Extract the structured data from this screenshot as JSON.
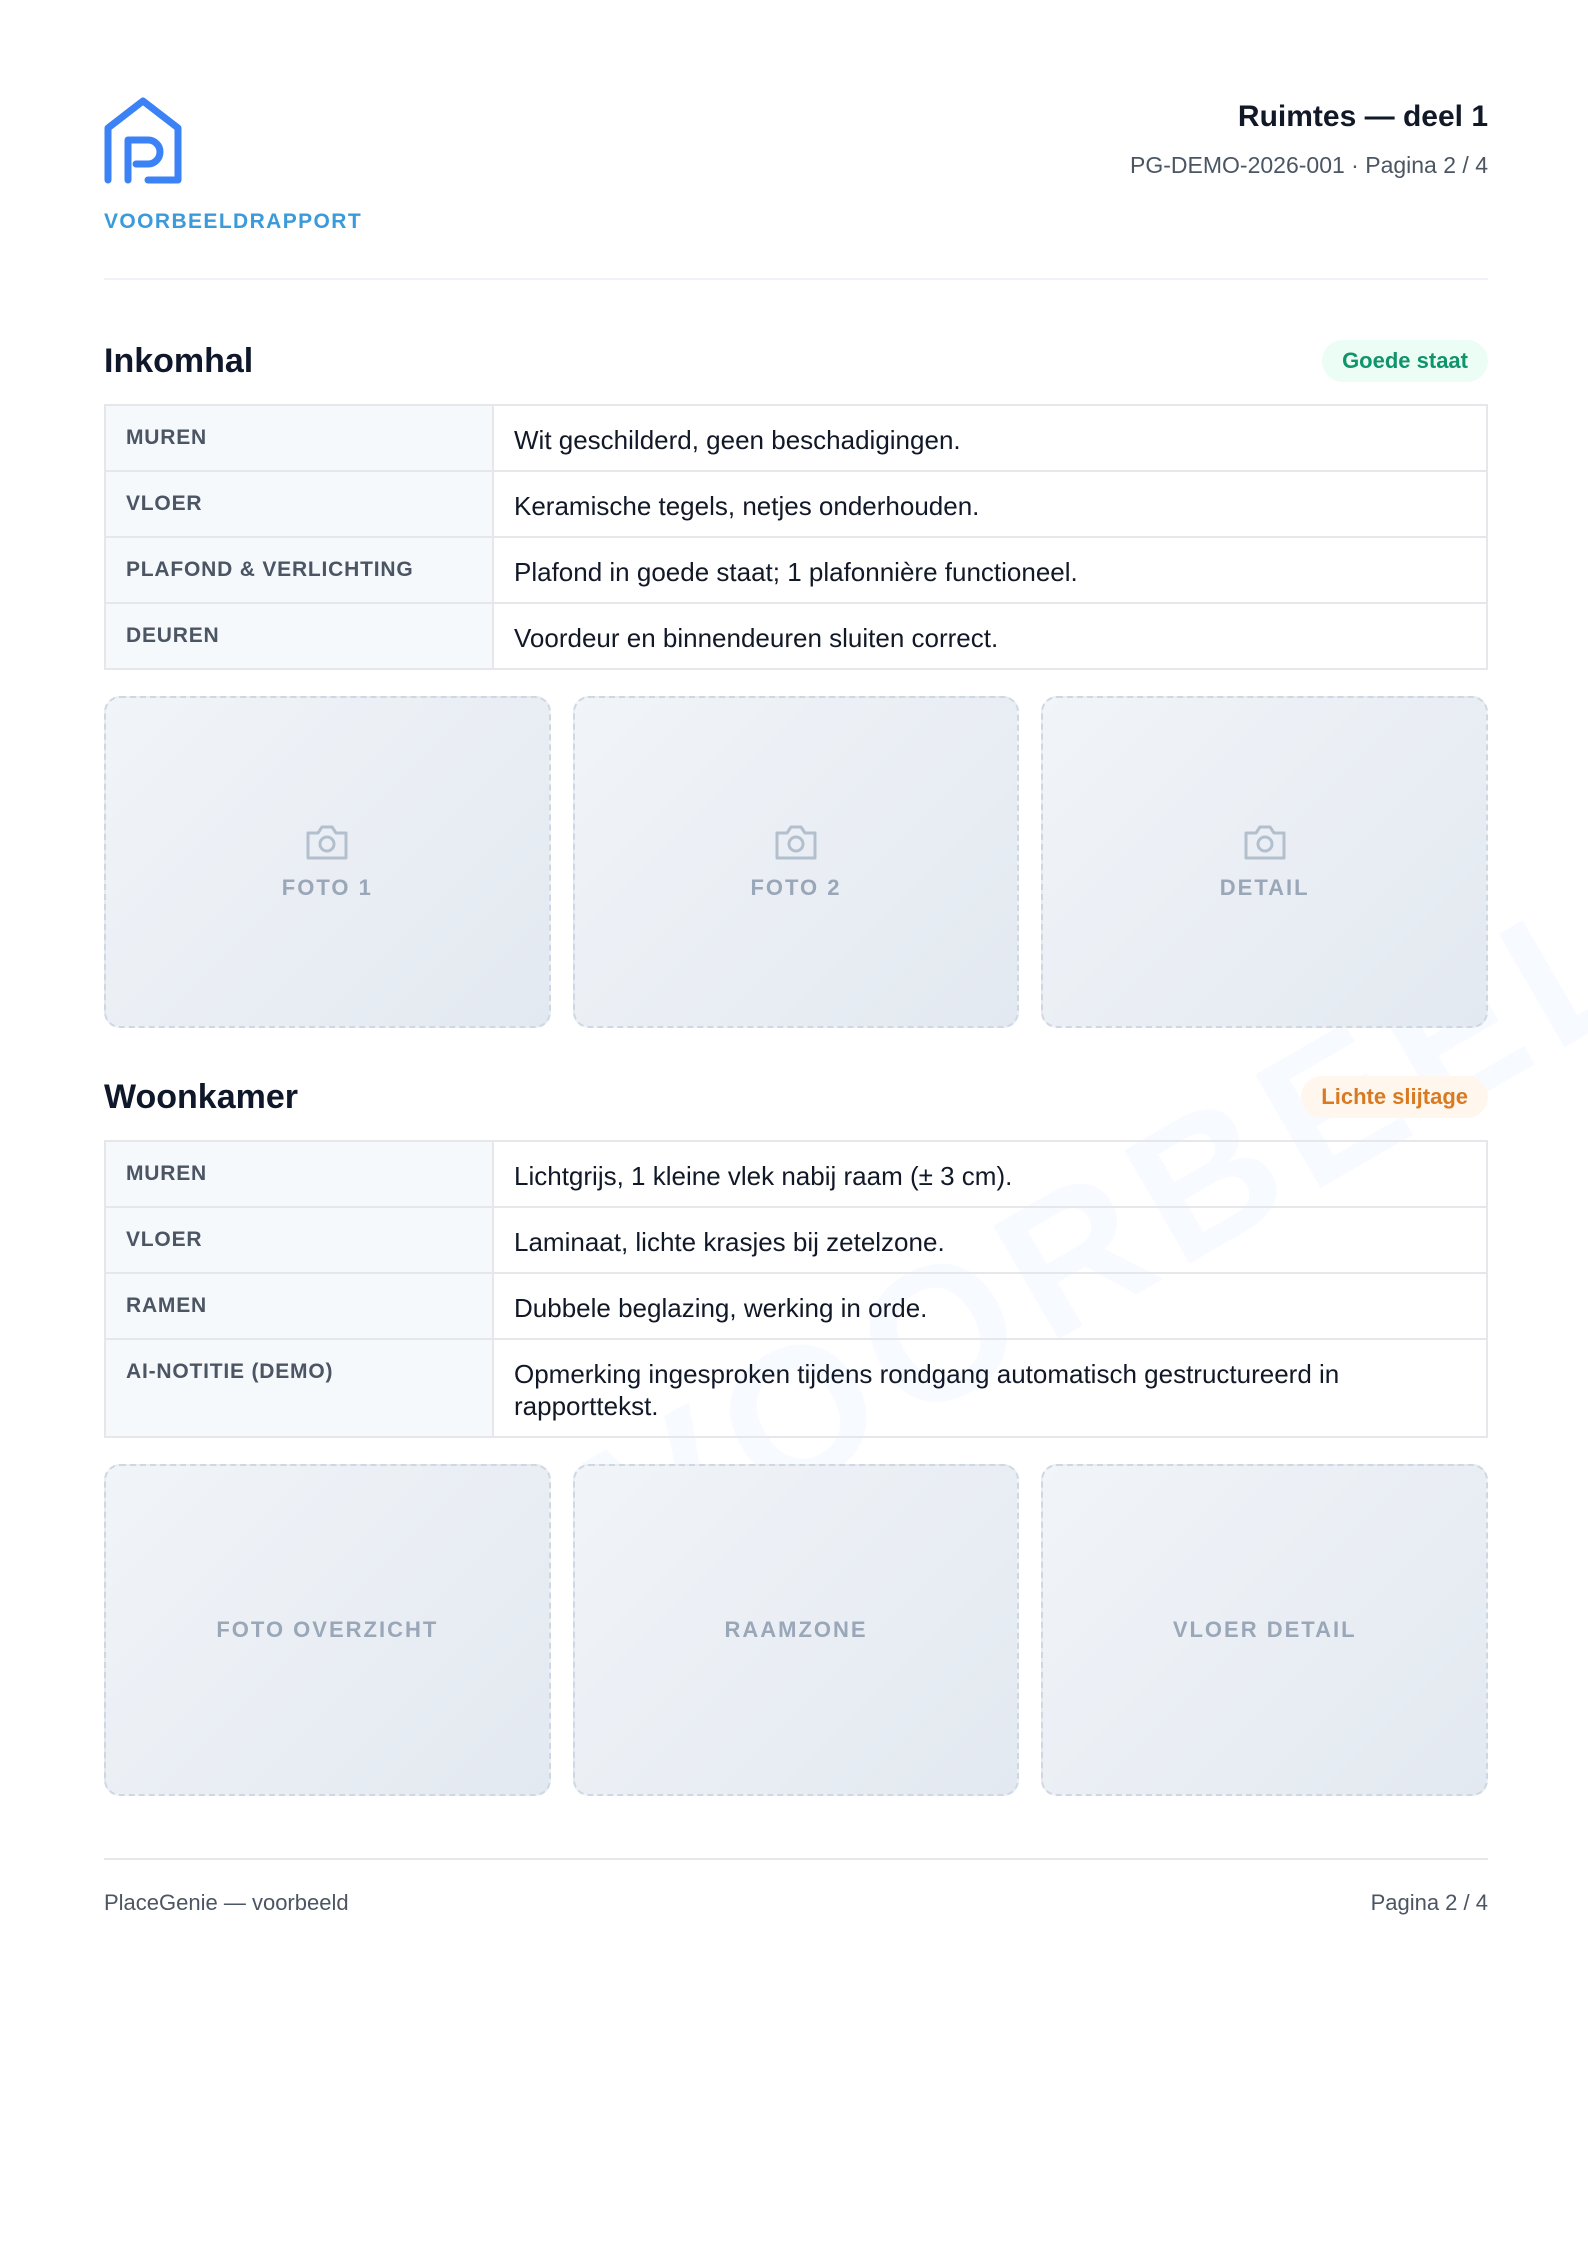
{
  "header": {
    "brand_label": "VOORBEELDRAPPORT",
    "title": "Ruimtes — deel 1",
    "meta": "PG-DEMO-2026-001 · Pagina 2 / 4"
  },
  "watermark": "VOORBEELD",
  "sections": [
    {
      "title": "Inkomhal",
      "badge": "Goede staat",
      "rows": [
        {
          "label": "MUREN",
          "value": "Wit geschilderd, geen beschadigingen."
        },
        {
          "label": "VLOER",
          "value": "Keramische tegels, netjes onderhouden."
        },
        {
          "label": "PLAFOND & VERLICHTING",
          "value": "Plafond in goede staat; 1 plafonnière functioneel."
        },
        {
          "label": "DEUREN",
          "value": "Voordeur en binnendeuren sluiten correct."
        }
      ],
      "photos": [
        "FOTO 1",
        "FOTO 2",
        "DETAIL"
      ]
    },
    {
      "title": "Woonkamer",
      "badge": "Lichte slijtage",
      "rows": [
        {
          "label": "MUREN",
          "value": "Lichtgrijs, 1 kleine vlek nabij raam (± 3 cm)."
        },
        {
          "label": "VLOER",
          "value": "Laminaat, lichte krasjes bij zetelzone."
        },
        {
          "label": "RAMEN",
          "value": "Dubbele beglazing, werking in orde."
        },
        {
          "label": "AI-NOTITIE (DEMO)",
          "value": "Opmerking ingesproken tijdens rondgang automatisch gestructureerd in rapporttekst."
        }
      ],
      "photos": [
        "FOTO OVERZICHT",
        "RAAMZONE",
        "VLOER DETAIL"
      ]
    }
  ],
  "footer": {
    "left": "PlaceGenie — voorbeeld",
    "right": "Pagina 2 / 4"
  },
  "icons": {
    "logo": "house-p-logo-icon",
    "photo": "camera-icon"
  },
  "colors": {
    "brand": "#3b82f6",
    "good": "#10946b",
    "wear": "#d97a23"
  }
}
